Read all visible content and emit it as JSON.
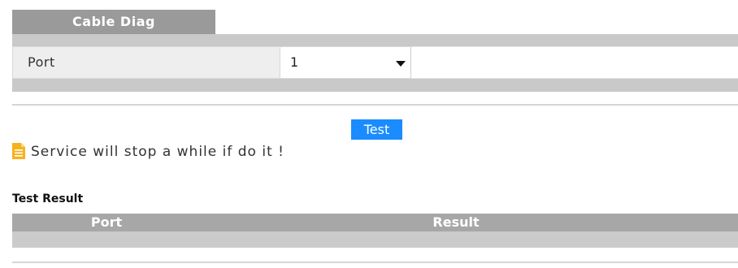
{
  "tab": {
    "label": "Cable Diag"
  },
  "form": {
    "port_label": "Port",
    "port_value": "1"
  },
  "actions": {
    "test_label": "Test"
  },
  "notice": {
    "icon": "note-icon",
    "text": "Service will stop a while if do it !"
  },
  "result": {
    "title": "Test Result",
    "columns": [
      "Port",
      "Result"
    ],
    "rows": []
  },
  "icons": {
    "dropdown": "chevron-down-icon",
    "notice": "note-icon"
  },
  "colors": {
    "accent": "#1a8cff",
    "tab_bg": "#9a9a9a",
    "table_header_bg": "#a7a7a7",
    "band_bg": "#c9c9c9",
    "notice_icon": "#f5b31b"
  }
}
